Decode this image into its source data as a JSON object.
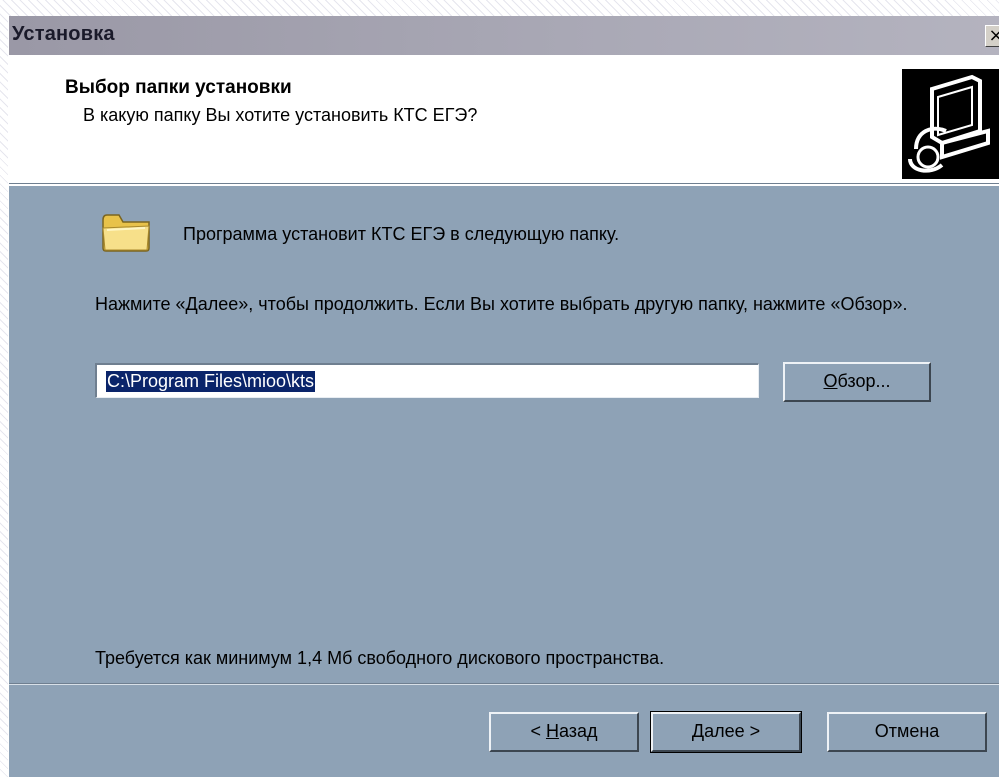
{
  "window": {
    "title": "Установка",
    "close_glyph": "×"
  },
  "header": {
    "title": "Выбор папки установки",
    "subtitle": "В какую папку Вы хотите установить КТС ЕГЭ?",
    "icon": "installer-computer-icon"
  },
  "body": {
    "folder_icon": "folder-icon",
    "message": "Программа установит КТС ЕГЭ в следующую папку.",
    "instruction": "Нажмите «Далее», чтобы продолжить. Если Вы хотите выбрать другую папку, нажмите «Обзор».",
    "path_value": "C:\\Program Files\\mioo\\kts",
    "browse_accel": "О",
    "browse_rest": "бзор...",
    "disk_requirement": "Требуется как минимум 1,4 Мб свободного дискового пространства."
  },
  "footer": {
    "back_prefix": "< ",
    "back_accel": "Н",
    "back_rest": "азад",
    "next_accel": "Д",
    "next_rest": "алее >",
    "cancel_label": "Отмена"
  },
  "colors": {
    "dialog_bg": "#8ea2b6",
    "title_bar": "#aaa9b6",
    "selection": "#0a246a"
  }
}
